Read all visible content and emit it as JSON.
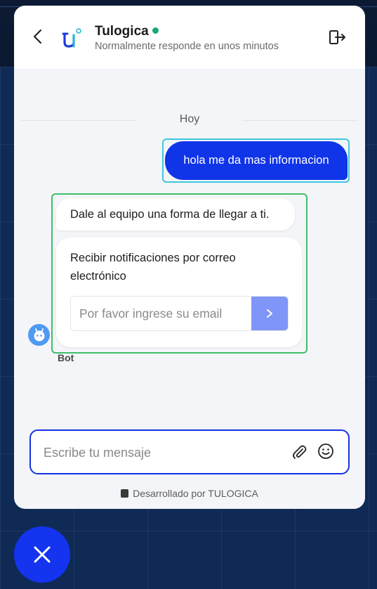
{
  "header": {
    "title": "Tulogica",
    "subtitle": "Normalmente responde en unos minutos",
    "status_color": "#18a97a"
  },
  "conversation": {
    "day_label": "Hoy",
    "user_message": "hola me da mas informacion",
    "bot_message": "Dale al equipo una forma de llegar a ti.",
    "email_card": {
      "title": "Recibir notificaciones por correo electrónico",
      "placeholder": "Por favor ingrese su email"
    },
    "bot_name": "Bot"
  },
  "composer": {
    "placeholder": "Escribe tu mensaje"
  },
  "footer": {
    "text": "Desarrollado por TULOGICA"
  },
  "colors": {
    "brand_blue": "#1034e8",
    "submit_blue": "#7f95f7"
  },
  "icons": [
    "back-arrow-icon",
    "tulogica-logo-icon",
    "exit-icon",
    "chevron-right-icon",
    "bot-avatar-icon",
    "paperclip-icon",
    "emoji-icon",
    "close-icon"
  ]
}
